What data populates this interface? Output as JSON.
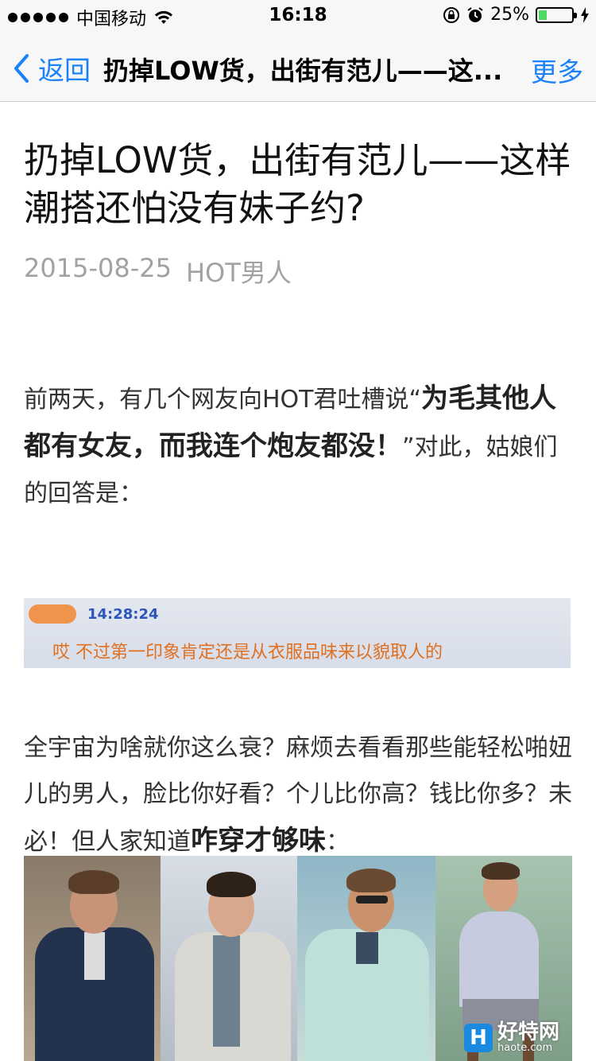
{
  "status_bar": {
    "carrier": "中国移动",
    "time": "16:18",
    "battery_percent_label": "25%",
    "battery_level": 0.25,
    "battery_color": "#4cd964"
  },
  "nav": {
    "back_label": "返回",
    "title": "扔掉LOW货，出街有范儿——这...",
    "more_label": "更多",
    "accent_color": "#1a82fb"
  },
  "article": {
    "title": "扔掉LOW货，出街有范儿——这样潮搭还怕没有妹子约?",
    "date": "2015-08-25",
    "source": "HOT男人",
    "p1_before": "前两天，有几个网友向HOT君吐槽说“",
    "p1_emph": "为毛其他人都有女友，而我连个炮友都没！",
    "p1_after": "”对此，姑娘们的回答是：",
    "chat_time": "14:28:24",
    "chat_message": "哎 不过第一印象肯定还是从衣服品味来以貌取人的",
    "p2_before": "全宇宙为啥就你这么衰？麻烦去看看那些能轻松啪妞儿的男人，脸比你好看？个儿比你高？钱比你多？未必！但人家知道",
    "p2_emph": "咋穿才够味",
    "p2_after": "："
  },
  "watermark": {
    "logo_letter": "H",
    "name": "好特网",
    "domain": "haote.com"
  },
  "icons": {
    "back": "chevron-left-icon",
    "wifi": "wifi-icon",
    "lock": "orientation-lock-icon",
    "alarm": "alarm-icon",
    "charging": "bolt-icon"
  }
}
